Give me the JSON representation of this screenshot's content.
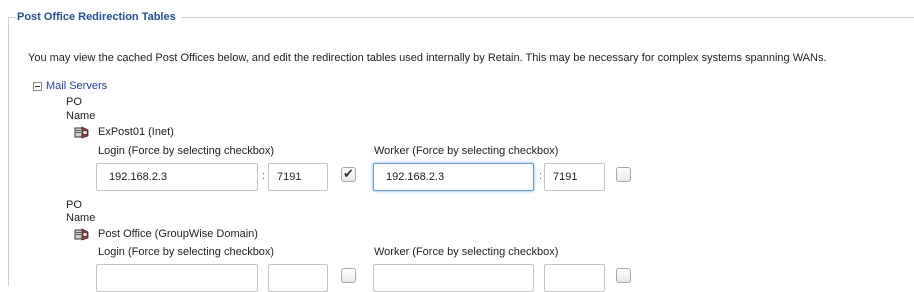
{
  "section": {
    "title": "Post Office Redirection Tables",
    "description": "You may view the cached Post Offices below, and edit the redirection tables used internally by Retain. This may be necessary for complex systems spanning WANs."
  },
  "tree": {
    "root_label": "Mail Servers"
  },
  "post_offices": [
    {
      "po_label_1": "PO",
      "po_label_2": "Name",
      "name": "ExPost01 (Inet)",
      "login_label": "Login (Force by selecting checkbox)",
      "login_ip": "192.168.2.3",
      "login_port": "7191",
      "login_forced": true,
      "worker_label": "Worker (Force by selecting checkbox)",
      "worker_ip": "192.168.2.3",
      "worker_port": "7191",
      "worker_forced": false
    },
    {
      "po_label_1": "PO",
      "po_label_2": "Name",
      "name": "Post Office (GroupWise Domain)",
      "login_label": "Login (Force by selecting checkbox)",
      "login_ip": "",
      "login_port": "",
      "login_forced": false,
      "worker_label": "Worker (Force by selecting checkbox)",
      "worker_ip": "",
      "worker_port": "",
      "worker_forced": false
    }
  ],
  "separator": ":",
  "check_glyph": "✔",
  "colors": {
    "legend": "#1f4e9c",
    "tree_link": "#1f3fbf",
    "focus": "#5b9be0"
  },
  "icons": {
    "tree_toggle": "collapse-icon",
    "server": "server-icon"
  }
}
